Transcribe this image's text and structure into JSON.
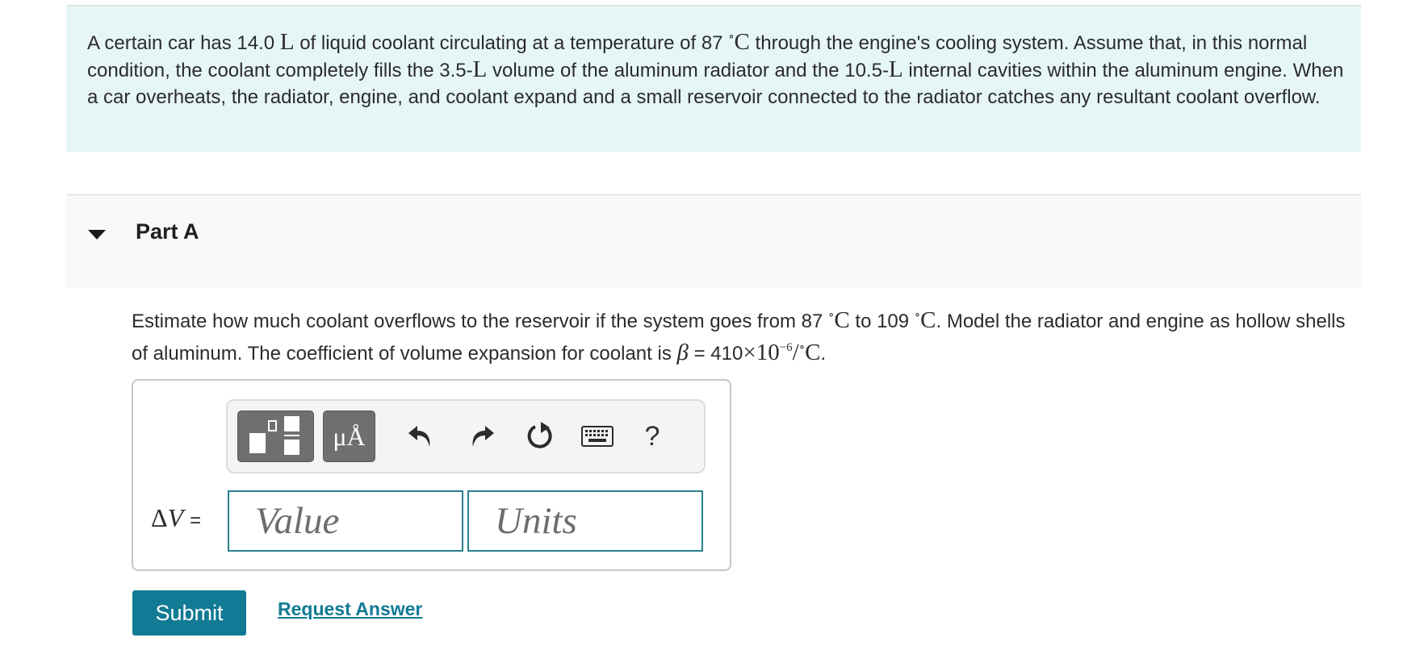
{
  "intro": {
    "t1": "A certain car has 14.0 ",
    "u1": "L",
    "t2": " of liquid coolant circulating at a temperature of 87 ",
    "deg1": "∘",
    "c1": "C",
    "t3": " through the engine's cooling system. Assume that, in this normal condition, the coolant completely fills the 3.5-",
    "u2": "L",
    "t4": " volume of the aluminum radiator and the 10.5-",
    "u3": "L",
    "t5": " internal cavities within the aluminum engine. When a car overheats, the radiator, engine, and coolant expand and a small reservoir connected to the radiator catches any resultant coolant overflow."
  },
  "part": {
    "title": "Part A"
  },
  "question": {
    "t1": "Estimate how much coolant overflows to the reservoir if the system goes from 87 ",
    "deg1": "∘",
    "c1": "C",
    "t2": " to 109 ",
    "deg2": "∘",
    "c2": "C",
    "t3": ". Model the radiator and engine as hollow shells of aluminum. The coefficient of volume expansion for coolant is ",
    "beta": "β",
    "t4": " = 410",
    "times": "×",
    "ten": "10",
    "exp": "−6",
    "slash": "/",
    "deg3": "∘",
    "c3": "C",
    "t5": "."
  },
  "toolbar": {
    "units_label": "μÅ",
    "help_label": "?",
    "icons": [
      "templates-icon",
      "units-icon",
      "undo-icon",
      "redo-icon",
      "reset-icon",
      "keyboard-icon",
      "help-icon"
    ]
  },
  "answer": {
    "label_delta": "Δ",
    "label_var": "V",
    "label_eq": "=",
    "value_placeholder": "Value",
    "units_placeholder": "Units"
  },
  "actions": {
    "submit_label": "Submit",
    "request_label": "Request Answer"
  },
  "colors": {
    "intro_bg": "#e6f6f6",
    "part_bg": "#f8f8f8",
    "accent": "#117a94",
    "field_border": "#2a7f8e",
    "tool_button": "#6f6f6f"
  }
}
